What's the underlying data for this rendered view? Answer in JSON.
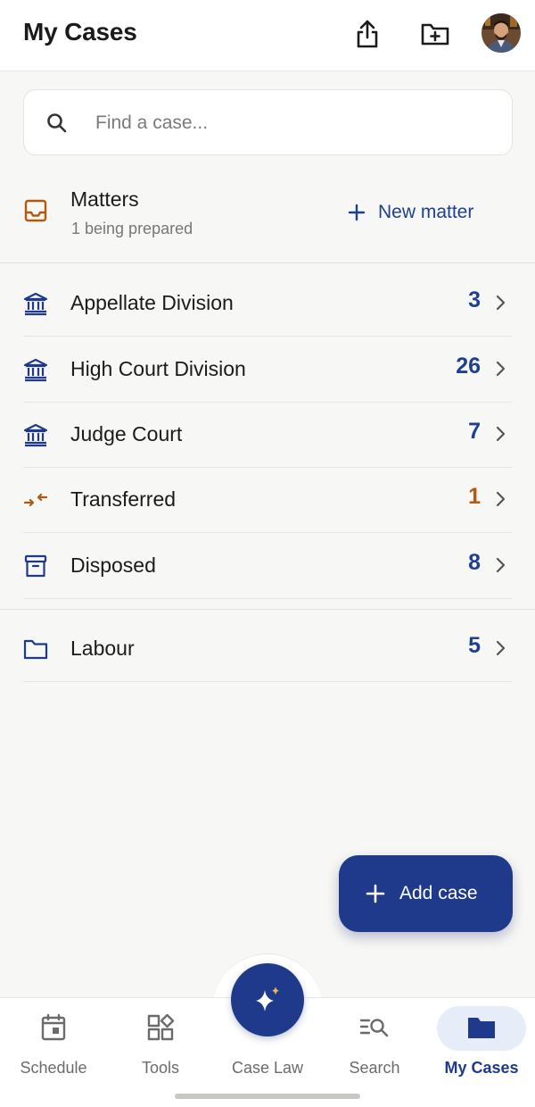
{
  "header": {
    "title": "My Cases",
    "share_icon": "share-icon",
    "new_folder_icon": "folder-plus-icon"
  },
  "search": {
    "placeholder": "Find a case..."
  },
  "matters": {
    "title": "Matters",
    "subtitle": "1 being prepared",
    "new_matter_label": "New matter"
  },
  "categories": [
    {
      "label": "Appellate Division",
      "count": "3",
      "icon": "court-icon"
    },
    {
      "label": "High Court Division",
      "count": "26",
      "icon": "court-icon"
    },
    {
      "label": "Judge Court",
      "count": "7",
      "icon": "court-icon"
    },
    {
      "label": "Transferred",
      "count": "1",
      "icon": "transfer-arrows-icon"
    },
    {
      "label": "Disposed",
      "count": "8",
      "icon": "archive-icon"
    }
  ],
  "folders": [
    {
      "label": "Labour",
      "count": "5",
      "icon": "folder-icon"
    }
  ],
  "fab": {
    "label": "Add case"
  },
  "nav": {
    "schedule": "Schedule",
    "tools": "Tools",
    "caselaw": "Case Law",
    "search": "Search",
    "mycases": "My Cases"
  },
  "colors": {
    "primary": "#1f3a8a",
    "accent_orange": "#b45a0e",
    "background": "#f7f7f5"
  }
}
